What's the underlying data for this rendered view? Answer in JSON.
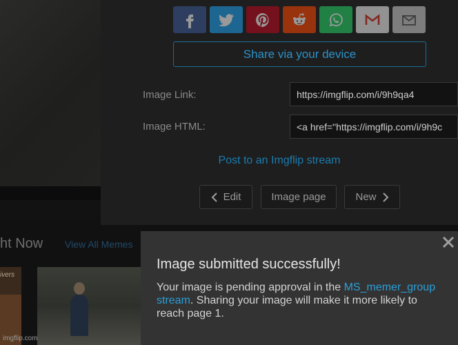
{
  "background": {
    "section_title": "ht Now",
    "view_all_label": "View All Memes",
    "thumb_text": "ivers",
    "watermark": "imgflip.com"
  },
  "share": {
    "device_label": "Share via your device",
    "image_link_label": "Image Link:",
    "image_link_value": "https://imgflip.com/i/9h9qa4",
    "image_html_label": "Image HTML:",
    "image_html_value": "<a href=\"https://imgflip.com/i/9h9c",
    "post_stream_label": "Post to an Imgflip stream",
    "edit_label": "Edit",
    "image_page_label": "Image page",
    "new_label": "New",
    "icons": [
      "facebook-icon",
      "twitter-icon",
      "pinterest-icon",
      "reddit-icon",
      "whatsapp-icon",
      "gmail-icon",
      "email-icon"
    ]
  },
  "toast": {
    "title": "Image submitted successfully!",
    "body_prefix": "Your image is pending approval in the ",
    "stream_link": "MS_memer_group stream",
    "body_suffix": ". Sharing your image will make it more likely to reach page 1."
  },
  "colors": {
    "accent": "#2a93c9",
    "facebook": "#3b5998",
    "twitter": "#1da1f2",
    "pinterest": "#bd081c",
    "reddit": "#ff4500",
    "whatsapp": "#25d366"
  }
}
